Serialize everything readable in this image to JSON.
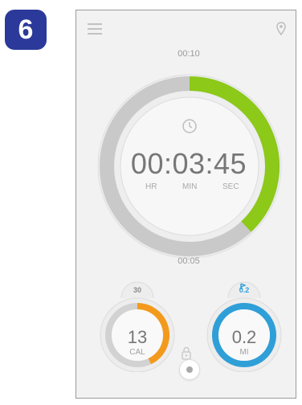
{
  "step_number": "6",
  "timer": {
    "top_label": "00:10",
    "bottom_label": "00:05",
    "time": "00:03:45",
    "units": {
      "hr": "HR",
      "min": "MIN",
      "sec": "SEC"
    },
    "progress_fraction": 0.38,
    "progress_color": "#8cc919"
  },
  "calories": {
    "value": "13",
    "unit": "CAL",
    "goal": "30",
    "progress_fraction": 0.43,
    "color": "#f39a1d"
  },
  "miles": {
    "value": "0.2",
    "unit": "MI",
    "goal": "0.2",
    "progress_fraction": 1.0,
    "color": "#2f9fd8"
  },
  "icons": {
    "menu": "menu-icon",
    "location": "location-pin-icon",
    "clock": "clock-icon",
    "lock": "lock-icon",
    "goal_flag": "flag-icon"
  }
}
